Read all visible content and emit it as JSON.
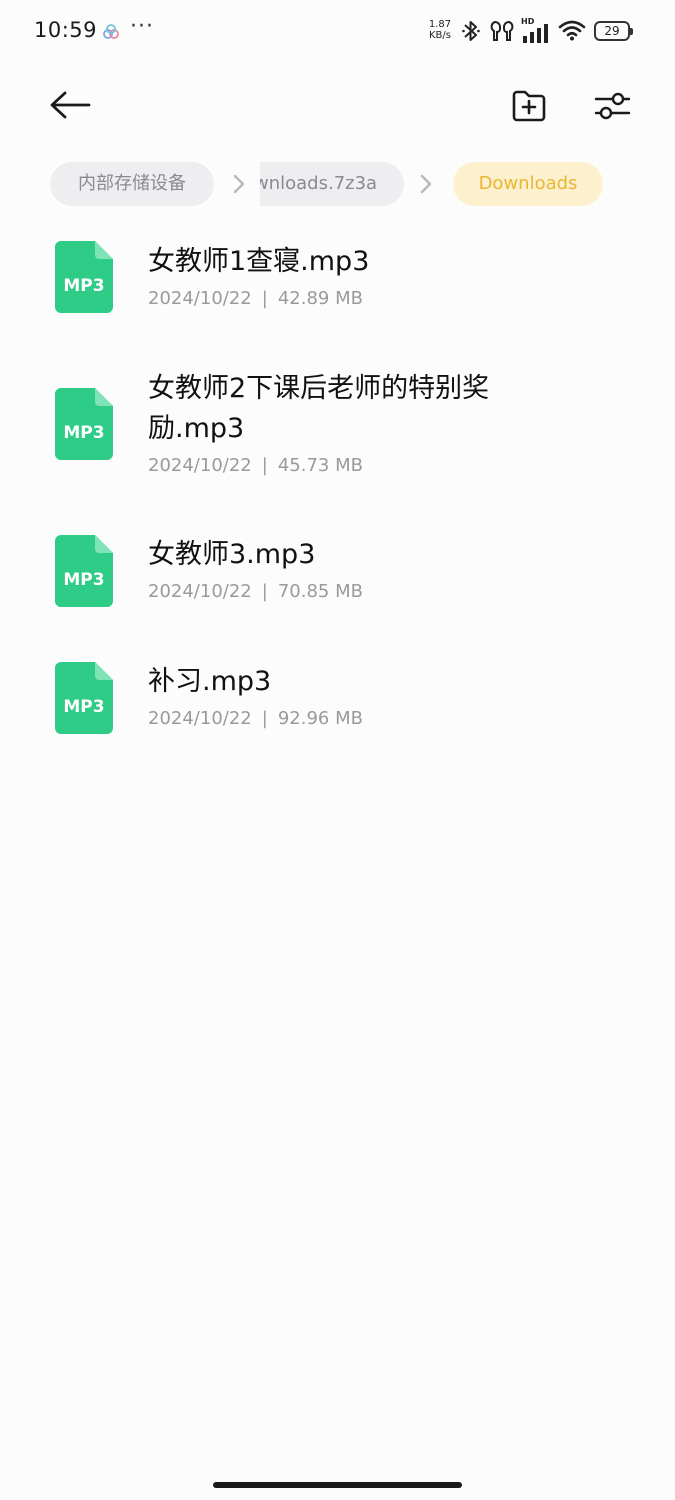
{
  "status_bar": {
    "time": "10:59",
    "more": "···",
    "net_speed_value": "1.87",
    "net_speed_unit": "KB/s",
    "signal_tag": "HD",
    "battery": "29"
  },
  "toolbar": {
    "back_icon": "arrow-left-icon",
    "new_folder_icon": "folder-plus-icon",
    "filter_icon": "sliders-icon"
  },
  "breadcrumb": {
    "items": [
      "内部存储设备",
      "wnloads.7z3a",
      "Downloads"
    ],
    "current_color": "#e8b632",
    "current_bg": "#fdf0cf"
  },
  "files": [
    {
      "icon_label": "MP3",
      "name": "女教师1查寝.mp3",
      "date": "2024/10/22",
      "size": "42.89 MB"
    },
    {
      "icon_label": "MP3",
      "name": "女教师2下课后老师的特别奖励.mp3",
      "date": "2024/10/22",
      "size": "45.73 MB"
    },
    {
      "icon_label": "MP3",
      "name": "女教师3.mp3",
      "date": "2024/10/22",
      "size": "70.85 MB"
    },
    {
      "icon_label": "MP3",
      "name": "补习.mp3",
      "date": "2024/10/22",
      "size": "92.96 MB"
    }
  ],
  "meta_separator": "|",
  "colors": {
    "mp3_icon": "#2ecc87",
    "mp3_icon_fold": "#7ee3b5"
  }
}
